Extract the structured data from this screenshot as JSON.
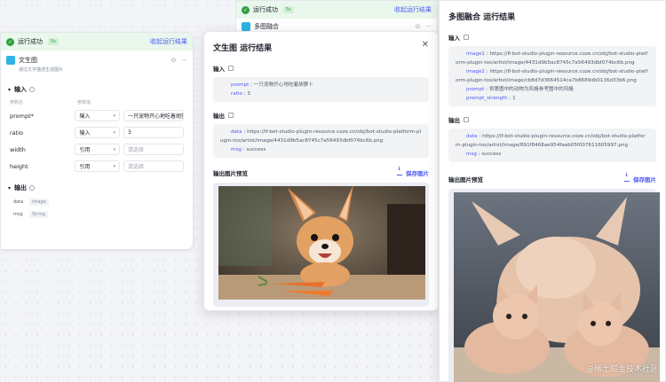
{
  "node_left": {
    "status": "运行成功",
    "duration": "5s",
    "view_result": "收起运行结果",
    "title": "文生图",
    "desc": "通过文字描述生成图片",
    "input_label": "输入",
    "col_name": "参数名",
    "col_value": "参数值",
    "params": [
      {
        "name": "prompt*",
        "type": "输入",
        "value": "一只宠物开心地吃着胡萝"
      },
      {
        "name": "ratio",
        "type": "输入",
        "value": "3"
      },
      {
        "name": "width",
        "type": "引用",
        "value": "请选择"
      },
      {
        "name": "height",
        "type": "引用",
        "value": "请选择"
      }
    ],
    "output_label": "输出",
    "outputs": [
      {
        "name": "data",
        "type": "Image"
      },
      {
        "name": "msg",
        "type": "String"
      }
    ]
  },
  "node_top": {
    "status": "运行成功",
    "duration": "5s",
    "view_result": "收起运行结果",
    "title": "多图融合"
  },
  "panel1": {
    "title": "文生图 运行结果",
    "input_label": "输入",
    "input_lines": [
      {
        "key": "prompt",
        "value": "一只宠物开心地吃着胡萝卜"
      },
      {
        "key": "ratio",
        "value": "3"
      }
    ],
    "output_label": "输出",
    "output_lines": [
      {
        "key": "data",
        "value": "https://lf-bot-studio-plugin-resource.coze.cn/obj/bot-studio-platform-plugin-tos/artist/image/4431d9b5ac8745c7a56493dbf074bc6b.png"
      },
      {
        "key": "msg",
        "value": "success"
      }
    ],
    "preview_label": "输出图片预览",
    "save_label": "保存图片"
  },
  "panel2": {
    "title": "多图融合 运行结果",
    "input_label": "输入",
    "input_lines": [
      {
        "key": "image1",
        "value": "https://lf-bot-studio-plugin-resource.coze.cn/obj/bot-studio-platform-plugin-tos/artist/image/4431d9b5ac8745c7a56493dbf074bc6b.png"
      },
      {
        "key": "image2",
        "value": "https://lf-bot-studio-plugin-resource.coze.cn/obj/bot-studio-platform-plugin-tos/artist/image/cb8d7d3664514ca7b8689db0136d33b6.png"
      },
      {
        "key": "prompt",
        "value": "将第图中的动物为风格参考图中的风格"
      },
      {
        "key": "prompt_strength",
        "value": "1"
      }
    ],
    "output_label": "输出",
    "output_lines": [
      {
        "key": "data",
        "value": "https://lf-bot-studio-plugin-resource.coze.cn/obj/bot-studio-platform-plugin-tos/artist/image/891f8468ae954faab05f007611605997.png"
      },
      {
        "key": "msg",
        "value": "success"
      }
    ],
    "preview_label": "输出图片预览",
    "save_label": "保存图片"
  },
  "watermark": "@稀土掘金技术社区"
}
